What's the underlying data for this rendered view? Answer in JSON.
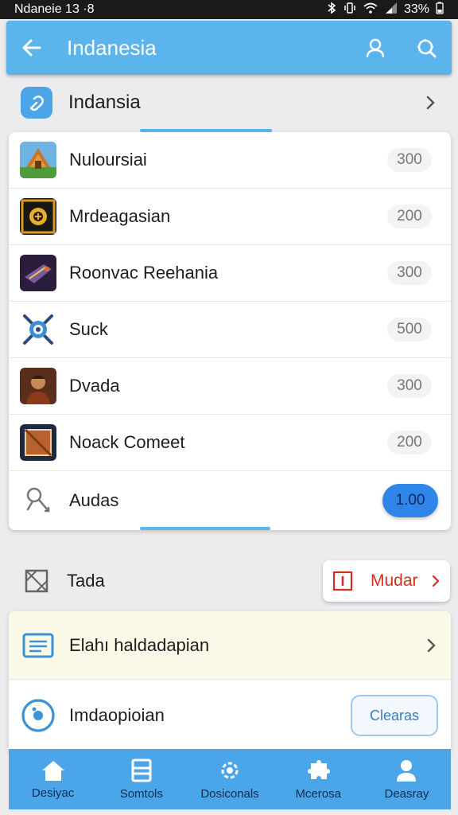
{
  "status_bar": {
    "left_text": "Ndaneie 13 ·8",
    "battery": "33%"
  },
  "app_bar": {
    "title": "Indanesia"
  },
  "section": {
    "label": "Indansia"
  },
  "list": [
    {
      "label": "Nuloursiai",
      "value": "300",
      "icon": "temple-icon"
    },
    {
      "label": "Mrdeagasian",
      "value": "200",
      "icon": "sun-emblem-icon"
    },
    {
      "label": "Roonvac Reehania",
      "value": "300",
      "icon": "spaceship-icon"
    },
    {
      "label": "Suck",
      "value": "500",
      "icon": "target-crossbones-icon"
    },
    {
      "label": "Dvada",
      "value": "300",
      "icon": "character-portrait-icon"
    },
    {
      "label": "Noack Comeet",
      "value": "200",
      "icon": "crate-icon"
    },
    {
      "label": "Audas",
      "value": "1.00",
      "icon": "bone-icon",
      "highlighted": true
    }
  ],
  "tada": {
    "label": "Tada",
    "button_label": "Mudar"
  },
  "bottom_card": {
    "row1_label": "Elahı haldadapian",
    "row2_label": "Imdaopioian",
    "row2_button": "Clearas"
  },
  "bottom_nav": [
    {
      "label": "Desiyac",
      "icon": "home-icon"
    },
    {
      "label": "Somtols",
      "icon": "document-icon"
    },
    {
      "label": "Dosiconals",
      "icon": "settings-icon"
    },
    {
      "label": "Mcerosa",
      "icon": "puzzle-icon"
    },
    {
      "label": "Deasray",
      "icon": "person-icon"
    }
  ],
  "colors": {
    "accent": "#5cb4ec",
    "primary_badge": "#2f86e8",
    "danger": "#d0301e"
  }
}
